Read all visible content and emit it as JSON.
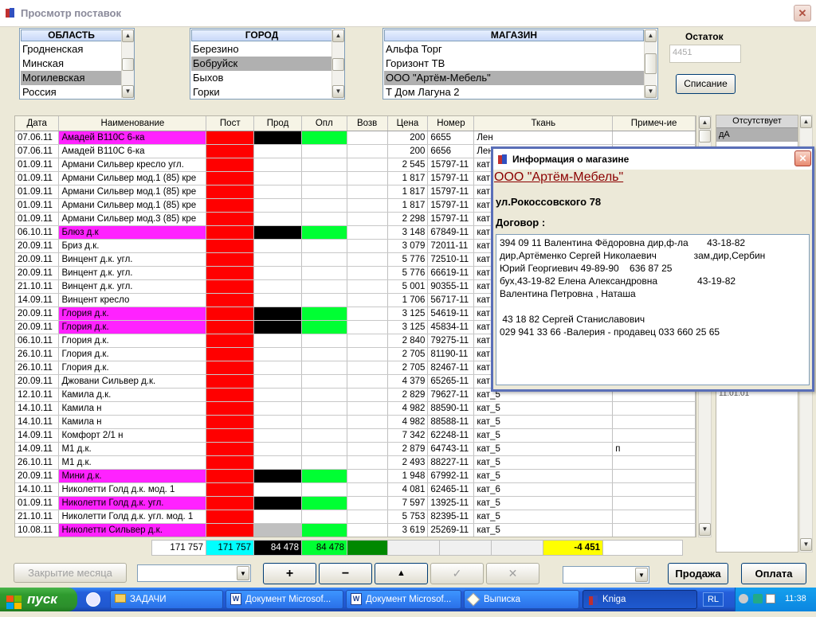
{
  "window": {
    "title": "Просмотр поставок",
    "close": "✕"
  },
  "region": {
    "header": "ОБЛАСТЬ",
    "items": [
      "Гродненская",
      "Минская",
      "Могилевская",
      "Россия"
    ],
    "selected": 2
  },
  "city": {
    "header": "ГОРОД",
    "items": [
      "Березино",
      "Бобруйск",
      "Быхов",
      "Горки"
    ],
    "selected": 1
  },
  "shop": {
    "header": "МАГАЗИН",
    "items": [
      "Альфа Торг",
      "Горизонт ТВ",
      "ООО \"Артём-Мебель\"",
      "Т Дом Лагуна 2"
    ],
    "selected": 2
  },
  "balance": {
    "label": "Остаток",
    "value": "4451"
  },
  "writeoff_button": "Списание",
  "columns": [
    "Дата",
    "Наименование",
    "Пост",
    "Прод",
    "Опл",
    "Возв",
    "Цена",
    "Номер",
    "Ткань",
    "Примеч-ие"
  ],
  "rows": [
    {
      "date": "07.06.11",
      "name": "Амадей В110С 6-ка",
      "post": "red",
      "prod": "black",
      "opl": "green",
      "price": "200",
      "num": "6655",
      "fabric": "Лен",
      "note": "",
      "hl": true
    },
    {
      "date": "07.06.11",
      "name": "Амадей В110С 6-ка",
      "post": "red",
      "prod": "",
      "opl": "",
      "price": "200",
      "num": "6656",
      "fabric": "Лен",
      "note": "",
      "hl": false
    },
    {
      "date": "01.09.11",
      "name": "Армани Сильвер кресло угл.",
      "post": "red",
      "prod": "",
      "opl": "",
      "price": "2 545",
      "num": "15797-11",
      "fabric": "кат",
      "note": "",
      "hl": false
    },
    {
      "date": "01.09.11",
      "name": "Армани Сильвер мод.1 (85) кре",
      "post": "red",
      "prod": "",
      "opl": "",
      "price": "1 817",
      "num": "15797-11",
      "fabric": "кат",
      "note": "",
      "hl": false
    },
    {
      "date": "01.09.11",
      "name": "Армани Сильвер мод.1 (85) кре",
      "post": "red",
      "prod": "",
      "opl": "",
      "price": "1 817",
      "num": "15797-11",
      "fabric": "кат",
      "note": "",
      "hl": false
    },
    {
      "date": "01.09.11",
      "name": "Армани Сильвер мод.1 (85) кре",
      "post": "red",
      "prod": "",
      "opl": "",
      "price": "1 817",
      "num": "15797-11",
      "fabric": "кат",
      "note": "",
      "hl": false
    },
    {
      "date": "01.09.11",
      "name": "Армани Сильвер мод.3 (85) кре",
      "post": "red",
      "prod": "",
      "opl": "",
      "price": "2 298",
      "num": "15797-11",
      "fabric": "кат",
      "note": "",
      "hl": false
    },
    {
      "date": "06.10.11",
      "name": "Блюз д.к",
      "post": "red",
      "prod": "black",
      "opl": "green",
      "price": "3 148",
      "num": "67849-11",
      "fabric": "кат",
      "note": "",
      "hl": true
    },
    {
      "date": "20.09.11",
      "name": "Бриз д.к.",
      "post": "red",
      "prod": "",
      "opl": "",
      "price": "3 079",
      "num": "72011-11",
      "fabric": "кат",
      "note": "",
      "hl": false
    },
    {
      "date": "20.09.11",
      "name": "Винцент д.к. угл.",
      "post": "red",
      "prod": "",
      "opl": "",
      "price": "5 776",
      "num": "72510-11",
      "fabric": "кат",
      "note": "",
      "hl": false
    },
    {
      "date": "20.09.11",
      "name": "Винцент д.к. угл.",
      "post": "red",
      "prod": "",
      "opl": "",
      "price": "5 776",
      "num": "66619-11",
      "fabric": "кат",
      "note": "",
      "hl": false
    },
    {
      "date": "21.10.11",
      "name": "Винцент д.к. угл.",
      "post": "red",
      "prod": "",
      "opl": "",
      "price": "5 001",
      "num": "90355-11",
      "fabric": "кат",
      "note": "",
      "hl": false
    },
    {
      "date": "14.09.11",
      "name": "Винцент кресло",
      "post": "red",
      "prod": "",
      "opl": "",
      "price": "1 706",
      "num": "56717-11",
      "fabric": "кат",
      "note": "",
      "hl": false
    },
    {
      "date": "20.09.11",
      "name": "Глория д.к.",
      "post": "red",
      "prod": "black",
      "opl": "green",
      "price": "3 125",
      "num": "54619-11",
      "fabric": "кат",
      "note": "",
      "hl": true
    },
    {
      "date": "20.09.11",
      "name": "Глория д.к.",
      "post": "red",
      "prod": "black",
      "opl": "green",
      "price": "3 125",
      "num": "45834-11",
      "fabric": "кат",
      "note": "",
      "hl": true
    },
    {
      "date": "06.10.11",
      "name": "Глория д.к.",
      "post": "red",
      "prod": "",
      "opl": "",
      "price": "2 840",
      "num": "79275-11",
      "fabric": "кат",
      "note": "",
      "hl": false
    },
    {
      "date": "26.10.11",
      "name": "Глория д.к.",
      "post": "red",
      "prod": "",
      "opl": "",
      "price": "2 705",
      "num": "81190-11",
      "fabric": "кат",
      "note": "",
      "hl": false
    },
    {
      "date": "26.10.11",
      "name": "Глория д.к.",
      "post": "red",
      "prod": "",
      "opl": "",
      "price": "2 705",
      "num": "82467-11",
      "fabric": "кат",
      "note": "",
      "hl": false
    },
    {
      "date": "20.09.11",
      "name": "Джовани Сильвер д.к.",
      "post": "red",
      "prod": "",
      "opl": "",
      "price": "4 379",
      "num": "65265-11",
      "fabric": "кат",
      "note": "",
      "hl": false
    },
    {
      "date": "12.10.11",
      "name": "Камила д.к.",
      "post": "red",
      "prod": "",
      "opl": "",
      "price": "2 829",
      "num": "79627-11",
      "fabric": "кат_5",
      "note": "",
      "hl": false
    },
    {
      "date": "14.10.11",
      "name": "Камила н",
      "post": "red",
      "prod": "",
      "opl": "",
      "price": "4 982",
      "num": "88590-11",
      "fabric": "кат_5",
      "note": "",
      "hl": false
    },
    {
      "date": "14.10.11",
      "name": "Камила н",
      "post": "red",
      "prod": "",
      "opl": "",
      "price": "4 982",
      "num": "88588-11",
      "fabric": "кат_5",
      "note": "",
      "hl": false
    },
    {
      "date": "14.09.11",
      "name": "Комфорт 2/1 н",
      "post": "red",
      "prod": "",
      "opl": "",
      "price": "7 342",
      "num": "62248-11",
      "fabric": "кат_5",
      "note": "",
      "hl": false
    },
    {
      "date": "14.09.11",
      "name": "М1 д.к.",
      "post": "red",
      "prod": "",
      "opl": "",
      "price": "2 879",
      "num": "64743-11",
      "fabric": "кат_5",
      "note": "п",
      "hl": false
    },
    {
      "date": "26.10.11",
      "name": "М1 д.к.",
      "post": "red",
      "prod": "",
      "opl": "",
      "price": "2 493",
      "num": "88227-11",
      "fabric": "кат_5",
      "note": "",
      "hl": false
    },
    {
      "date": "20.09.11",
      "name": "Мини д.к.",
      "post": "red",
      "prod": "black",
      "opl": "green",
      "price": "1 948",
      "num": "67992-11",
      "fabric": "кат_5",
      "note": "",
      "hl": true
    },
    {
      "date": "14.10.11",
      "name": "Николетти Голд д.к. мод. 1",
      "post": "red",
      "prod": "",
      "opl": "",
      "price": "4 081",
      "num": "62465-11",
      "fabric": "кат_6",
      "note": "",
      "hl": false
    },
    {
      "date": "01.09.11",
      "name": "Николетти Голд д.к. угл.",
      "post": "red",
      "prod": "black",
      "opl": "green",
      "price": "7 597",
      "num": "13925-11",
      "fabric": "кат_5",
      "note": "",
      "hl": true
    },
    {
      "date": "21.10.11",
      "name": "Николетти Голд д.к. угл. мод. 1",
      "post": "red",
      "prod": "",
      "opl": "",
      "price": "5 753",
      "num": "82395-11",
      "fabric": "кат_5",
      "note": "",
      "hl": false
    },
    {
      "date": "10.08.11",
      "name": "Николетти Сильвер д.к.",
      "post": "red",
      "prod": "gray",
      "opl": "green",
      "price": "3 619",
      "num": "25269-11",
      "fabric": "кат_5",
      "note": "",
      "hl": true
    }
  ],
  "totals": {
    "sum": "171 757",
    "post": "171 757",
    "prod": "84 478",
    "opl": "84 478",
    "balance": "-4 451"
  },
  "side": {
    "header": "Отсутствует",
    "value": "дА",
    "hidden_value": "11.01.01"
  },
  "buttons": {
    "close_month": "Закрытие месяца",
    "plus": "+",
    "minus": "−",
    "up": "▲",
    "check": "✓",
    "cross": "✕",
    "sale": "Продажа",
    "payment": "Оплата"
  },
  "popup": {
    "title": "Информация о магазине",
    "shop": "ООО \"Артём-Мебель\"",
    "address": "ул.Рокоссовского 78",
    "contract_label": "Договор :",
    "memo": "394 09 11 Валентина Фёдоровна дир,ф-ла       43-18-82\nдир,Артёменко Сергей Николаевич              зам,дир,Сербин\nЮрий Георгиевич 49-89-90    636 87 25\nбух,43-19-82 Елена Александровна               43-19-82\nВалентина Петровна , Наташа\n\n 43 18 82 Сергей Станиславович\n029 941 33 66 -Валерия - продавец 033 660 25 65"
  },
  "taskbar": {
    "start": "пуск",
    "items": [
      "ЗАДАЧИ",
      "Документ Microsof...",
      "Документ Microsof...",
      "Выписка",
      "Kniga"
    ],
    "lang": "RL",
    "time": "11:38"
  }
}
